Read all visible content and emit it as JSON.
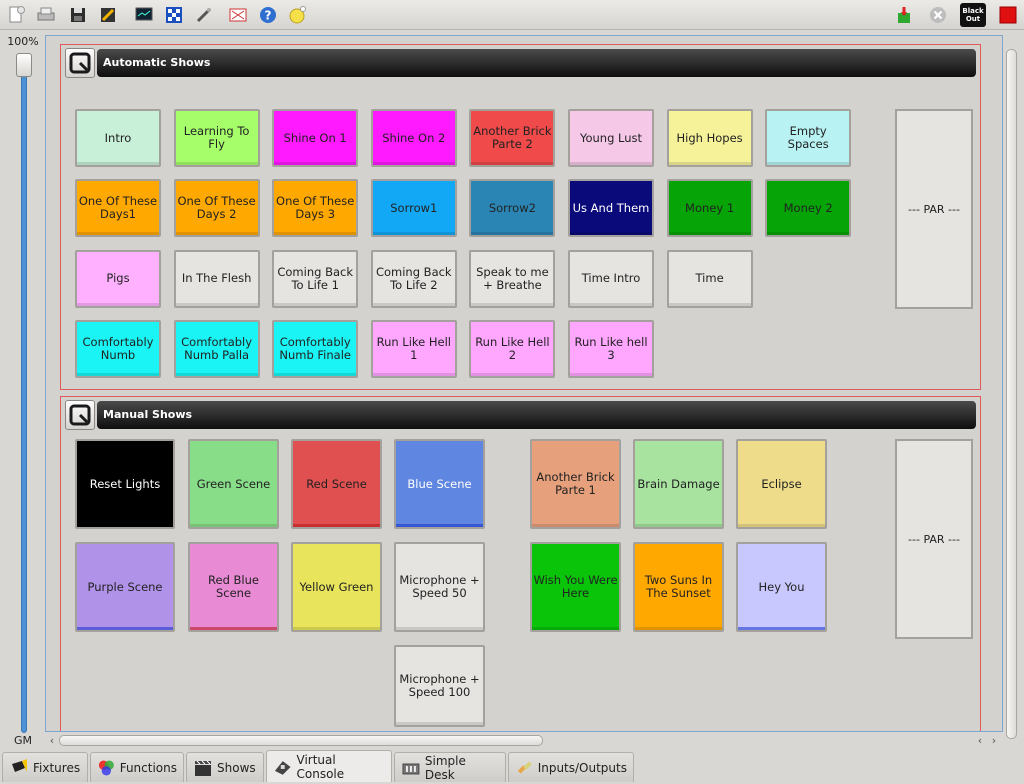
{
  "toolbar": {
    "left_icons": [
      "new-document-icon",
      "print-icon",
      "save-icon",
      "edit-mode-icon",
      "monitor-icon",
      "address-tool-icon",
      "wand-icon",
      "fullscreen-icon",
      "help-icon",
      "about-icon"
    ],
    "right_icons": [
      "live-edit-icon",
      "stop-all-icon",
      "blackout-icon",
      "red-stop-icon"
    ],
    "blackout_label": "Black Out"
  },
  "grand_master": {
    "percent": "100%",
    "label": "GM",
    "level": 1.0
  },
  "frames": [
    {
      "title": "Automatic Shows",
      "slider_label": "--- PAR ---",
      "buttons": [
        {
          "label": "Intro",
          "color": "#c8f0d8"
        },
        {
          "label": "Learning To Fly",
          "color": "#a6ff6a"
        },
        {
          "label": "Shine On 1",
          "color": "#ff1aff"
        },
        {
          "label": "Shine On 2",
          "color": "#ff1aff"
        },
        {
          "label": "Another Brick Parte 2",
          "color": "#f04a4a"
        },
        {
          "label": "Young Lust",
          "color": "#f6c8e8"
        },
        {
          "label": "High Hopes",
          "color": "#f6f29a"
        },
        {
          "label": "Empty Spaces",
          "color": "#b8f2f2"
        },
        {
          "label": "One Of These Days1",
          "color": "#ffa800"
        },
        {
          "label": "One Of These Days 2",
          "color": "#ffa800"
        },
        {
          "label": "One Of These Days 3",
          "color": "#ffa800"
        },
        {
          "label": "Sorrow1",
          "color": "#12a8f5"
        },
        {
          "label": "Sorrow2",
          "color": "#2a85b5"
        },
        {
          "label": "Us And Them",
          "color": "#0b0a7a",
          "text_color": "#ffffff"
        },
        {
          "label": "Money 1",
          "color": "#06a406"
        },
        {
          "label": "Money 2",
          "color": "#06a406"
        },
        {
          "label": "Pigs",
          "color": "#ffb0ff"
        },
        {
          "label": "In The Flesh",
          "color": "#e6e4e1"
        },
        {
          "label": "Coming Back To Life 1",
          "color": "#e6e4e1"
        },
        {
          "label": "Coming Back To Life 2",
          "color": "#e6e4e1"
        },
        {
          "label": "Speak to me + Breathe",
          "color": "#e6e4e1"
        },
        {
          "label": "Time Intro",
          "color": "#e6e4e1"
        },
        {
          "label": "Time",
          "color": "#e6e4e1"
        },
        {
          "label": "Comfortably Numb",
          "color": "#1af4f4"
        },
        {
          "label": "Comfortably Numb Palla",
          "color": "#1af4f4"
        },
        {
          "label": "Comfortably Numb Finale",
          "color": "#1af4f4"
        },
        {
          "label": "Run Like Hell 1",
          "color": "#ffa6ff"
        },
        {
          "label": "Run Like Hell 2",
          "color": "#ffa6ff"
        },
        {
          "label": "Run Like hell 3",
          "color": "#ffa6ff"
        }
      ]
    },
    {
      "title": "Manual Shows",
      "slider_label": "--- PAR ---",
      "buttons": [
        {
          "label": "Reset Lights",
          "color": "#000000",
          "text_color": "#ffffff"
        },
        {
          "label": "Green Scene",
          "color": "#88dd88"
        },
        {
          "label": "Red Scene",
          "color": "#e05050"
        },
        {
          "label": "Blue Scene",
          "color": "#5f86e0",
          "text_color": "#ffffff"
        },
        {
          "label": "Another Brick Parte 1",
          "color": "#e6a07c"
        },
        {
          "label": "Brain Damage",
          "color": "#a8e4a0"
        },
        {
          "label": "Eclipse",
          "color": "#eedc8a"
        },
        {
          "label": "Purple Scene",
          "color": "#b092e8"
        },
        {
          "label": "Red Blue Scene",
          "color": "#e88ad4"
        },
        {
          "label": "Yellow Green",
          "color": "#e8e45c"
        },
        {
          "label": "Microphone + Speed 50",
          "color": "#e6e4e1"
        },
        {
          "label": "Wish You Were Here",
          "color": "#0ac40a"
        },
        {
          "label": "Two Suns In The Sunset",
          "color": "#ffa800"
        },
        {
          "label": "Hey You",
          "color": "#c8c8ff"
        },
        {
          "label": "Microphone + Speed 100",
          "color": "#e6e4e1"
        }
      ]
    }
  ],
  "tabs": [
    {
      "label": "Fixtures",
      "icon": "fixtures-icon",
      "active": false
    },
    {
      "label": "Functions",
      "icon": "functions-icon",
      "active": false
    },
    {
      "label": "Shows",
      "icon": "shows-icon",
      "active": false
    },
    {
      "label": "Virtual Console",
      "icon": "virtual-console-icon",
      "active": true
    },
    {
      "label": "Simple Desk",
      "icon": "simple-desk-icon",
      "active": false
    },
    {
      "label": "Inputs/Outputs",
      "icon": "inputs-outputs-icon",
      "active": false
    }
  ]
}
